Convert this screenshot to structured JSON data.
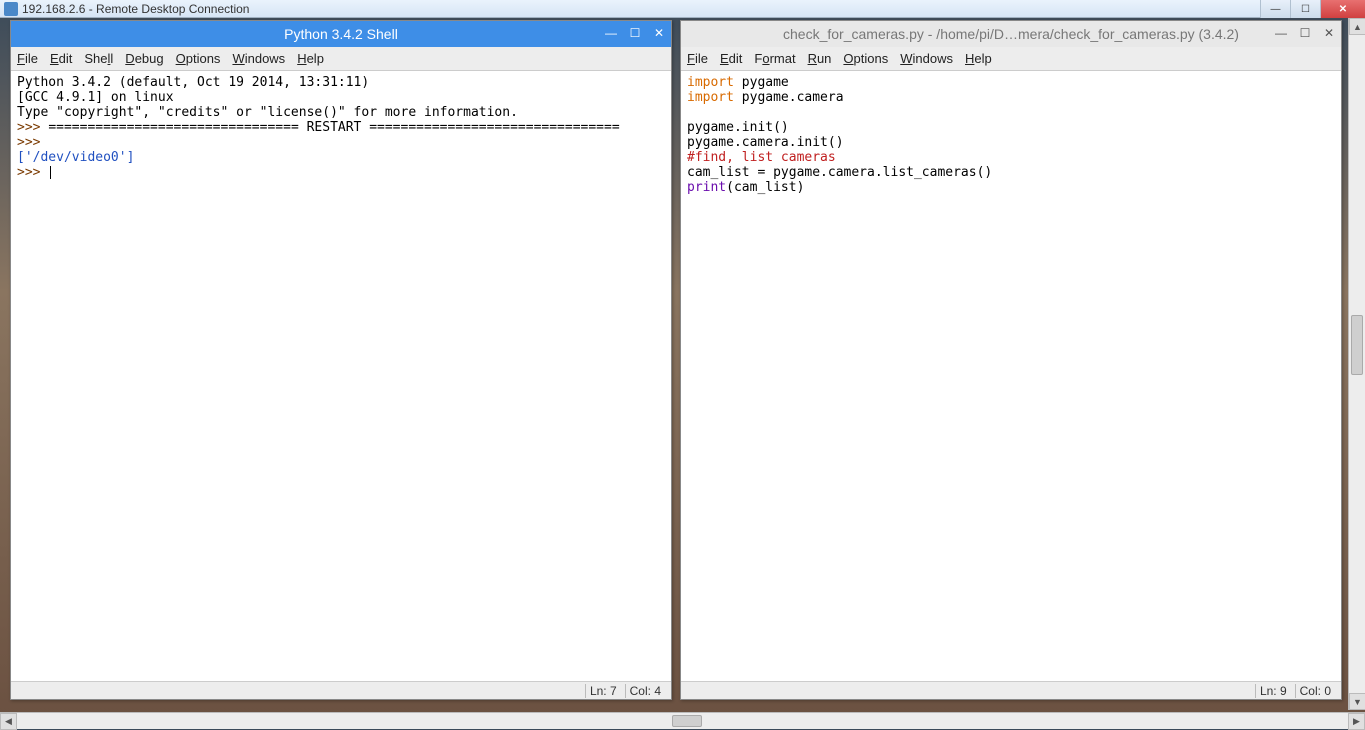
{
  "rdp": {
    "title": "192.168.2.6 - Remote Desktop Connection"
  },
  "shell": {
    "title": "Python 3.4.2 Shell",
    "menus": [
      "File",
      "Edit",
      "Shell",
      "Debug",
      "Options",
      "Windows",
      "Help"
    ],
    "banner_l1": "Python 3.4.2 (default, Oct 19 2014, 13:31:11) ",
    "banner_l2": "[GCC 4.9.1] on linux",
    "banner_l3": "Type \"copyright\", \"credits\" or \"license()\" for more information.",
    "prompt": ">>> ",
    "restart_line": "================================ RESTART ================================",
    "output": "['/dev/video0']",
    "status_ln": "Ln: 7",
    "status_col": "Col: 4"
  },
  "editor": {
    "title": "check_for_cameras.py - /home/pi/D…mera/check_for_cameras.py (3.4.2)",
    "menus": [
      "File",
      "Edit",
      "Format",
      "Run",
      "Options",
      "Windows",
      "Help"
    ],
    "code": {
      "l1_kw": "import",
      "l1_mod": " pygame",
      "l2_kw": "import",
      "l2_mod": " pygame.camera",
      "l4": "pygame.init()",
      "l5": "pygame.camera.init()",
      "l6_comment": "#find, list cameras",
      "l7": "cam_list = pygame.camera.list_cameras()",
      "l8_fn": "print",
      "l8_rest": "(cam_list)"
    },
    "status_ln": "Ln: 9",
    "status_col": "Col: 0"
  }
}
